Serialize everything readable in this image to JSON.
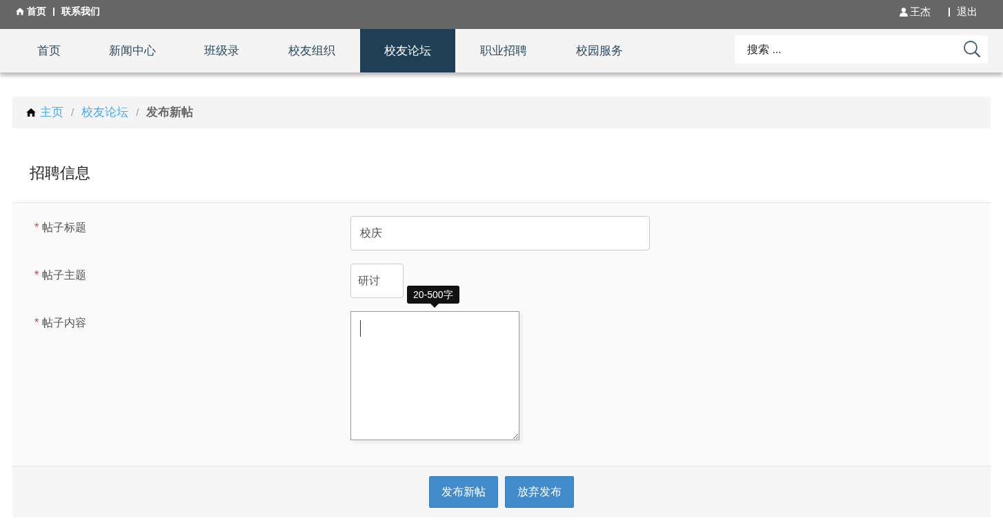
{
  "top_bar": {
    "left_links": [
      "首页",
      "联系我们"
    ],
    "user": "王杰",
    "logout": "退出"
  },
  "nav": {
    "items": [
      {
        "label": "首页",
        "selected": false
      },
      {
        "label": "新闻中心",
        "selected": false
      },
      {
        "label": "班级录",
        "selected": false
      },
      {
        "label": "校友组织",
        "selected": false
      },
      {
        "label": "校友论坛",
        "selected": true
      },
      {
        "label": "职业招聘",
        "selected": false
      },
      {
        "label": "校园服务",
        "selected": false
      }
    ],
    "search": {
      "placeholder": "搜索 ..."
    }
  },
  "breadcrumb_separator": "/",
  "breadcrumb": [
    {
      "label": "主页",
      "kind": "link"
    },
    {
      "label": "校友论坛",
      "kind": "link"
    },
    {
      "label": "发布新帖",
      "kind": "current"
    }
  ],
  "form": {
    "title": "招聘信息",
    "fields": [
      {
        "label": "帖子标题",
        "required_mark": "*",
        "kind": "text",
        "value": "校庆"
      },
      {
        "label": "帖子主题",
        "required_mark": "*",
        "kind": "short",
        "value": "研讨"
      },
      {
        "label": "帖子内容",
        "required_mark": "*",
        "kind": "textarea",
        "tooltip": "20-500字"
      }
    ],
    "buttons": [
      "发布新帖",
      "放弃发布"
    ]
  }
}
